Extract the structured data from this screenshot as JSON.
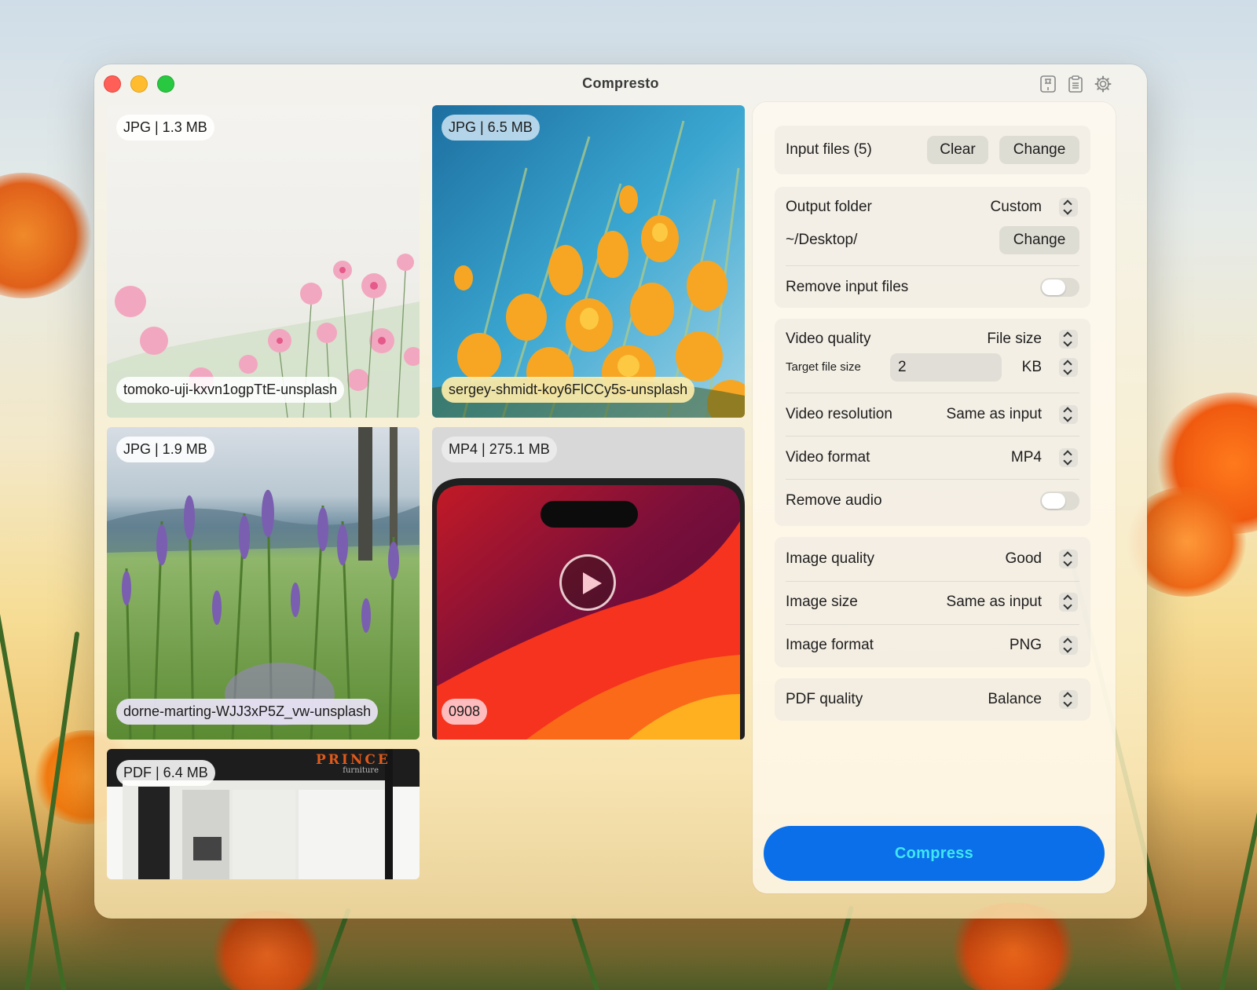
{
  "window": {
    "title": "Compresto"
  },
  "toolbar": {
    "icons": [
      "pin-icon",
      "clipboard-icon",
      "gear-icon"
    ]
  },
  "files": [
    {
      "badge": "JPG | 1.3 MB",
      "name": "tomoko-uji-kxvn1ogpTtE-unsplash"
    },
    {
      "badge": "JPG | 6.5 MB",
      "name": "sergey-shmidt-koy6FlCCy5s-unsplash"
    },
    {
      "badge": "JPG | 1.9 MB",
      "name": "dorne-marting-WJJ3xP5Z_vw-unsplash"
    },
    {
      "badge": "MP4 | 275.1 MB",
      "name": "0908"
    },
    {
      "badge": "PDF | 6.4 MB",
      "logo": "PRINCE",
      "logo_sub": "furniture"
    }
  ],
  "panel": {
    "input_files": {
      "label": "Input files (5)",
      "clear": "Clear",
      "change": "Change"
    },
    "output": {
      "label": "Output folder",
      "value": "Custom",
      "path": "~/Desktop/",
      "change": "Change",
      "remove_label": "Remove input files",
      "remove_on": false
    },
    "video": {
      "quality_label": "Video quality",
      "quality_value": "File size",
      "target_label": "Target file size",
      "target_value": "2",
      "target_unit": "KB",
      "resolution_label": "Video resolution",
      "resolution_value": "Same as input",
      "format_label": "Video format",
      "format_value": "MP4",
      "audio_label": "Remove audio",
      "audio_on": false
    },
    "image": {
      "quality_label": "Image quality",
      "quality_value": "Good",
      "size_label": "Image size",
      "size_value": "Same as input",
      "format_label": "Image format",
      "format_value": "PNG"
    },
    "pdf": {
      "quality_label": "PDF quality",
      "quality_value": "Balance"
    },
    "compress": "Compress"
  }
}
